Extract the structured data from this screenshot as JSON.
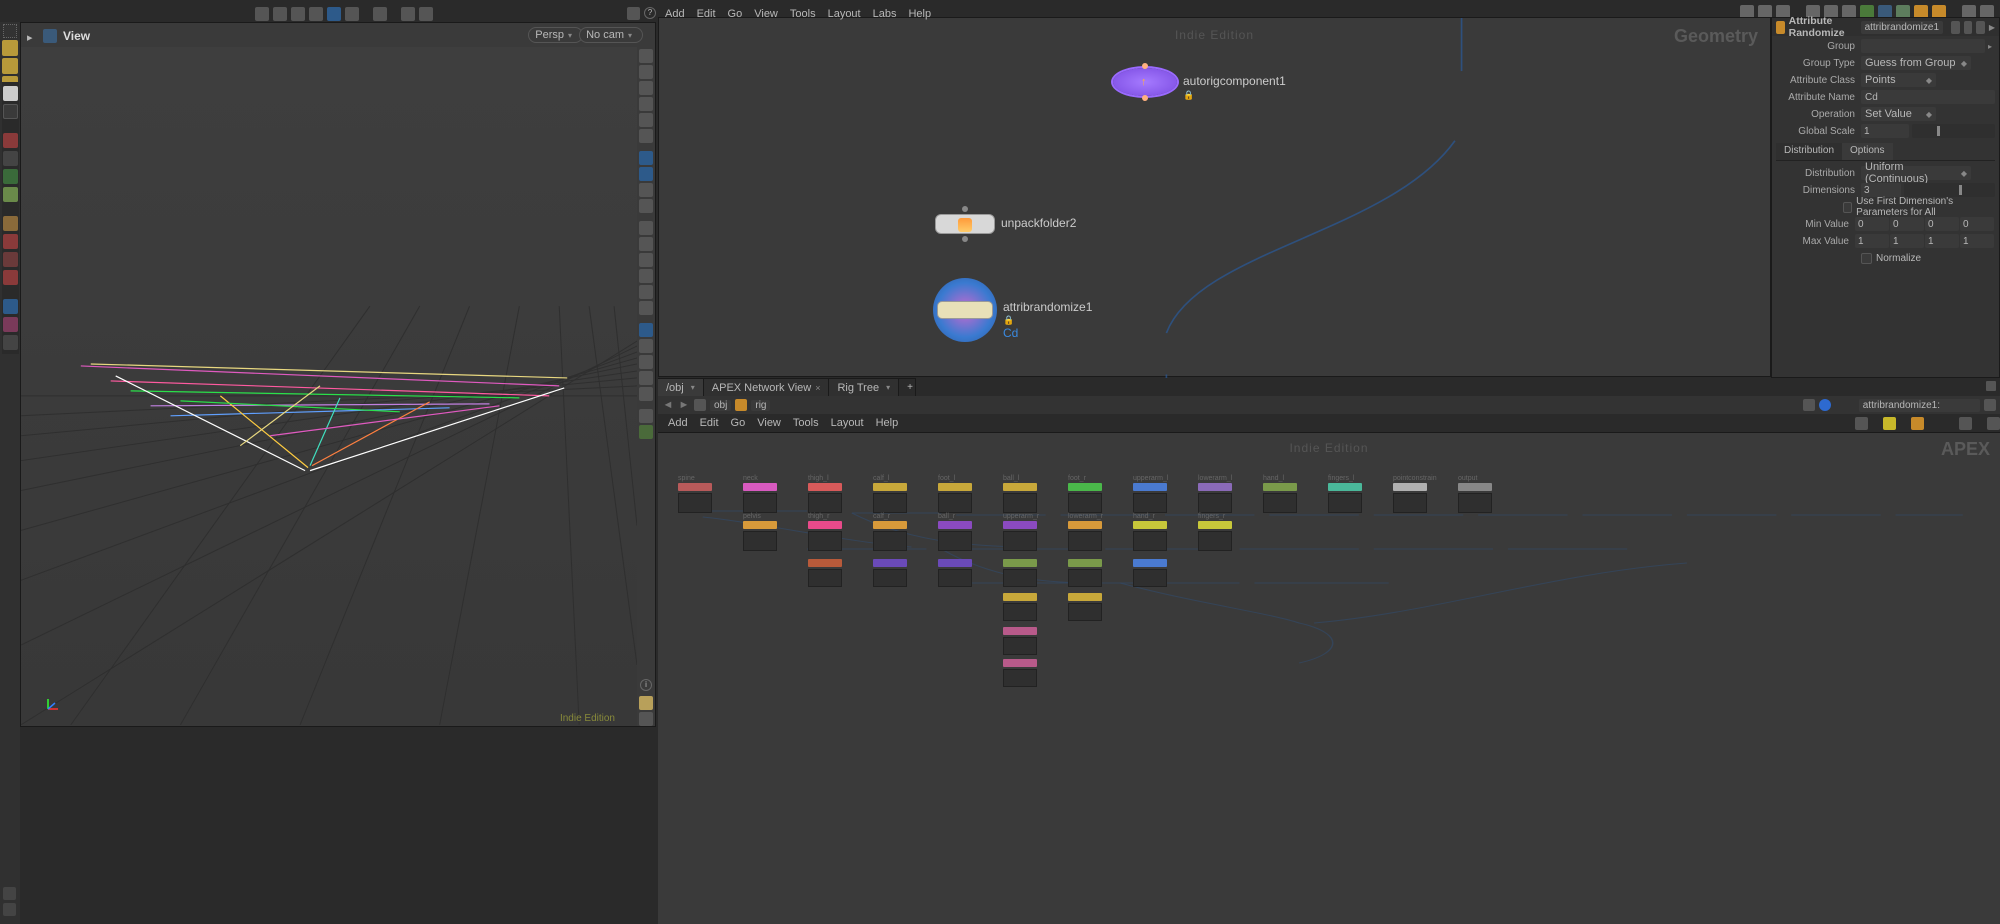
{
  "app_menu": [
    "Add",
    "Edit",
    "Go",
    "View",
    "Tools",
    "Layout",
    "Labs",
    "Help"
  ],
  "viewport": {
    "title": "View",
    "persp_pill": "Persp",
    "cam_pill": "No cam",
    "footer_watermark": "Indie Edition"
  },
  "network_top": {
    "context": "Geometry",
    "watermark": "Indie Edition",
    "nodes": {
      "autorig": {
        "label": "autorigcomponent1"
      },
      "unpack": {
        "label": "unpackfolder2"
      },
      "attrib": {
        "label": "attribrandomize1",
        "sublabel": "Cd"
      }
    }
  },
  "tabs": {
    "path_root": "/obj",
    "apex_tab": "APEX Network View",
    "rig_tab": "Rig Tree",
    "path_crumb1": "obj",
    "path_crumb2": "rig",
    "selected_path": "attribrandomize1:"
  },
  "bottom_menu": [
    "Add",
    "Edit",
    "Go",
    "View",
    "Tools",
    "Layout",
    "Help"
  ],
  "network_bottom": {
    "context": "APEX",
    "watermark": "Indie Edition",
    "row1_labels": [
      "spine",
      "neck",
      "thigh_l",
      "calf_l",
      "foot_l",
      "ball_l",
      "foot_r",
      "upperarm_l",
      "lowerarm_l",
      "hand_l",
      "fingers_l",
      "pointconstrain",
      "output"
    ],
    "row2_labels": [
      "pelvis",
      "thigh_r",
      "calf_r",
      "ball_r",
      "upperarm_r",
      "lowerarm_r",
      "hand_r",
      "fingers_r"
    ]
  },
  "params": {
    "header_title": "Attribute Randomize",
    "node_name": "attribrandomize1",
    "group_label": "Group",
    "group_value": "",
    "group_type_label": "Group Type",
    "group_type_value": "Guess from Group",
    "attr_class_label": "Attribute Class",
    "attr_class_value": "Points",
    "attr_name_label": "Attribute Name",
    "attr_name_value": "Cd",
    "operation_label": "Operation",
    "operation_value": "Set Value",
    "global_scale_label": "Global Scale",
    "global_scale_value": "1",
    "tabs": [
      "Distribution",
      "Options"
    ],
    "distribution_label": "Distribution",
    "distribution_value": "Uniform (Continuous)",
    "dimensions_label": "Dimensions",
    "dimensions_value": "3",
    "use_first_label": "Use First Dimension's Parameters for All",
    "min_label": "Min Value",
    "max_label": "Max Value",
    "min0": "0",
    "min1": "0",
    "min2": "0",
    "min3": "0",
    "max0": "1",
    "max1": "1",
    "max2": "1",
    "max3": "1",
    "normalize_label": "Normalize"
  }
}
